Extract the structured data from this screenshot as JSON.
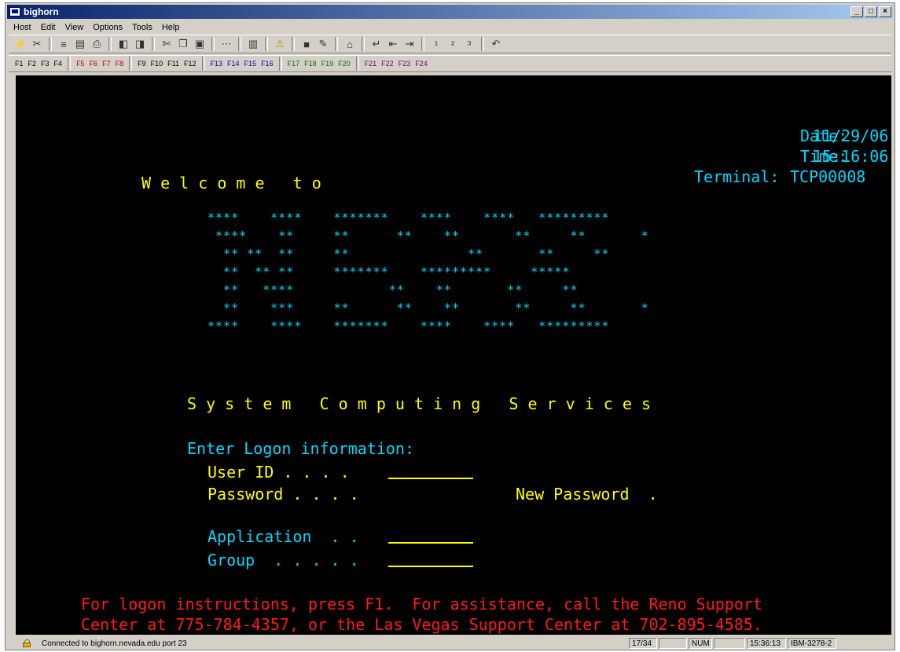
{
  "window": {
    "title": "bighorn"
  },
  "menu": [
    "Host",
    "Edit",
    "View",
    "Options",
    "Tools",
    "Help"
  ],
  "toolbar": {
    "icons": [
      "connect-icon",
      "disconnect-icon",
      "transfer-icon",
      "receive-icon",
      "print-icon",
      "session-icon",
      "session2-icon",
      "cut-icon",
      "copy-icon",
      "paste-icon",
      "more-icon",
      "chart-icon",
      "alert-icon",
      "screen-icon",
      "pen-icon",
      "home-icon",
      "enter-icon",
      "backtab-icon",
      "tab-icon",
      "attn-icon",
      "sysreq-icon",
      "clear-icon",
      "undo-icon"
    ]
  },
  "pf_keys": [
    "F1",
    "F2",
    "F3",
    "F4",
    "F5",
    "F6",
    "F7",
    "F8",
    "F9",
    "F10",
    "F11",
    "F12",
    "F13",
    "F14",
    "F15",
    "F16",
    "F17",
    "F18",
    "F19",
    "F20",
    "F21",
    "F22",
    "F23",
    "F24"
  ],
  "terminal": {
    "date_label": "Date:",
    "date_value": "11/29/06",
    "time_label": "Time:",
    "time_value": "15:16:06",
    "terminal_label": "Terminal:",
    "terminal_value": "TCP00008",
    "welcome": "W e l c o m e   t o",
    "banner": "****    ****    *******    ****    ****   *********\n ****    **     **      **    **       **     **       *\n  ** **  **     **               **       **     **\n  **  ** **     *******    *********     *****\n  **   ****            **    **       **     **\n  **    ***     **      **    **       **     **       *\n****    ****    *******    ****    ****   *********",
    "system": "S y s t e m   C o m p u t i n g   S e r v i c e s",
    "logon_prompt": "Enter Logon information:",
    "userid_label": "User ID . . . .",
    "password_label": "Password . . . .",
    "new_password_label": "New Password  .",
    "application_label": "Application  . .",
    "group_label": "Group  . . . . .",
    "help_line1": "For logon instructions, press F1.  For assistance, call the Reno Support",
    "help_line2": "Center at 775-784-4357, or the Las Vegas Support Center at 702-895-4585."
  },
  "status": {
    "message": "Connected to bighorn.nevada.edu port 23",
    "cursor": "17/34",
    "num": "NUM",
    "clock": "15:36:13",
    "terminal_type": "IBM-3278-2"
  }
}
